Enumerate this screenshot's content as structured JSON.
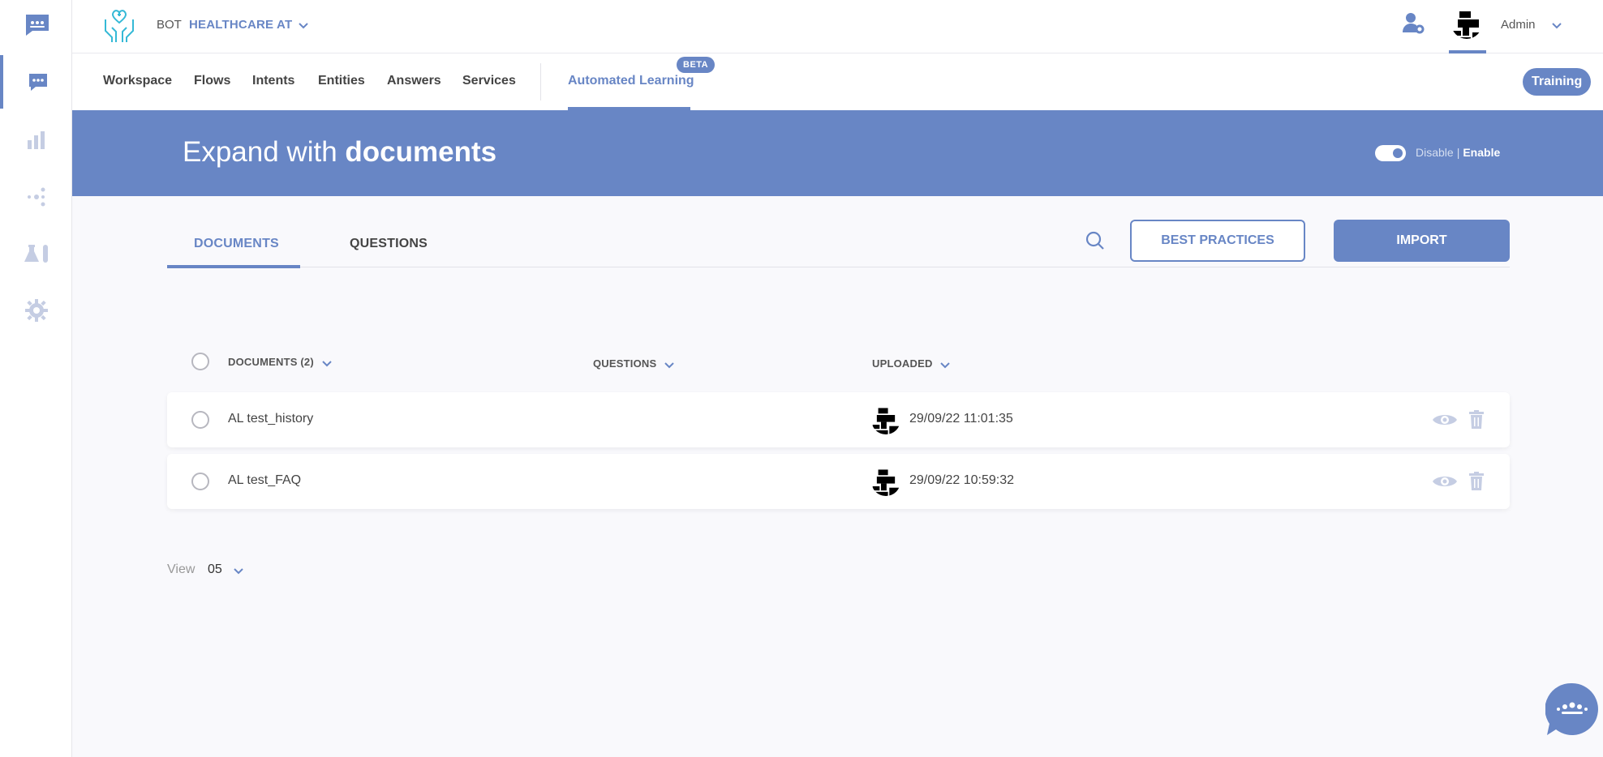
{
  "colors": {
    "accent": "#6886c5",
    "muted_icon": "#c5cde3",
    "text": "#444444"
  },
  "header": {
    "bot_label": "BOT",
    "bot_name": "HEALTHCARE AT",
    "user_name": "Admin"
  },
  "nav": {
    "items": [
      "Workspace",
      "Flows",
      "Intents",
      "Entities",
      "Answers",
      "Services"
    ],
    "active_item": "Automated Learning",
    "beta_badge": "BETA",
    "training_button": "Training"
  },
  "banner": {
    "title_prefix": "Expand with",
    "title_bold": "documents",
    "toggle_disable": "Disable",
    "toggle_separator": "|",
    "toggle_enable": "Enable",
    "toggle_state": "enabled"
  },
  "tabs": [
    {
      "label": "DOCUMENTS",
      "active": true
    },
    {
      "label": "QUESTIONS",
      "active": false
    }
  ],
  "actions": {
    "best_practices": "BEST PRACTICES",
    "import": "IMPORT"
  },
  "table": {
    "columns": [
      "DOCUMENTS (2)",
      "QUESTIONS",
      "UPLOADED"
    ],
    "rows": [
      {
        "name": "AL test_history",
        "questions": "",
        "uploaded": "29/09/22 11:01:35"
      },
      {
        "name": "AL test_FAQ",
        "questions": "",
        "uploaded": "29/09/22 10:59:32"
      }
    ]
  },
  "pagination": {
    "view_label": "View",
    "view_value": "05"
  },
  "sidebar": {
    "items": [
      "chat-icon",
      "bar-chart-icon",
      "share-nodes-icon",
      "lab-flask-icon",
      "gear-icon"
    ],
    "active_index": 0
  }
}
